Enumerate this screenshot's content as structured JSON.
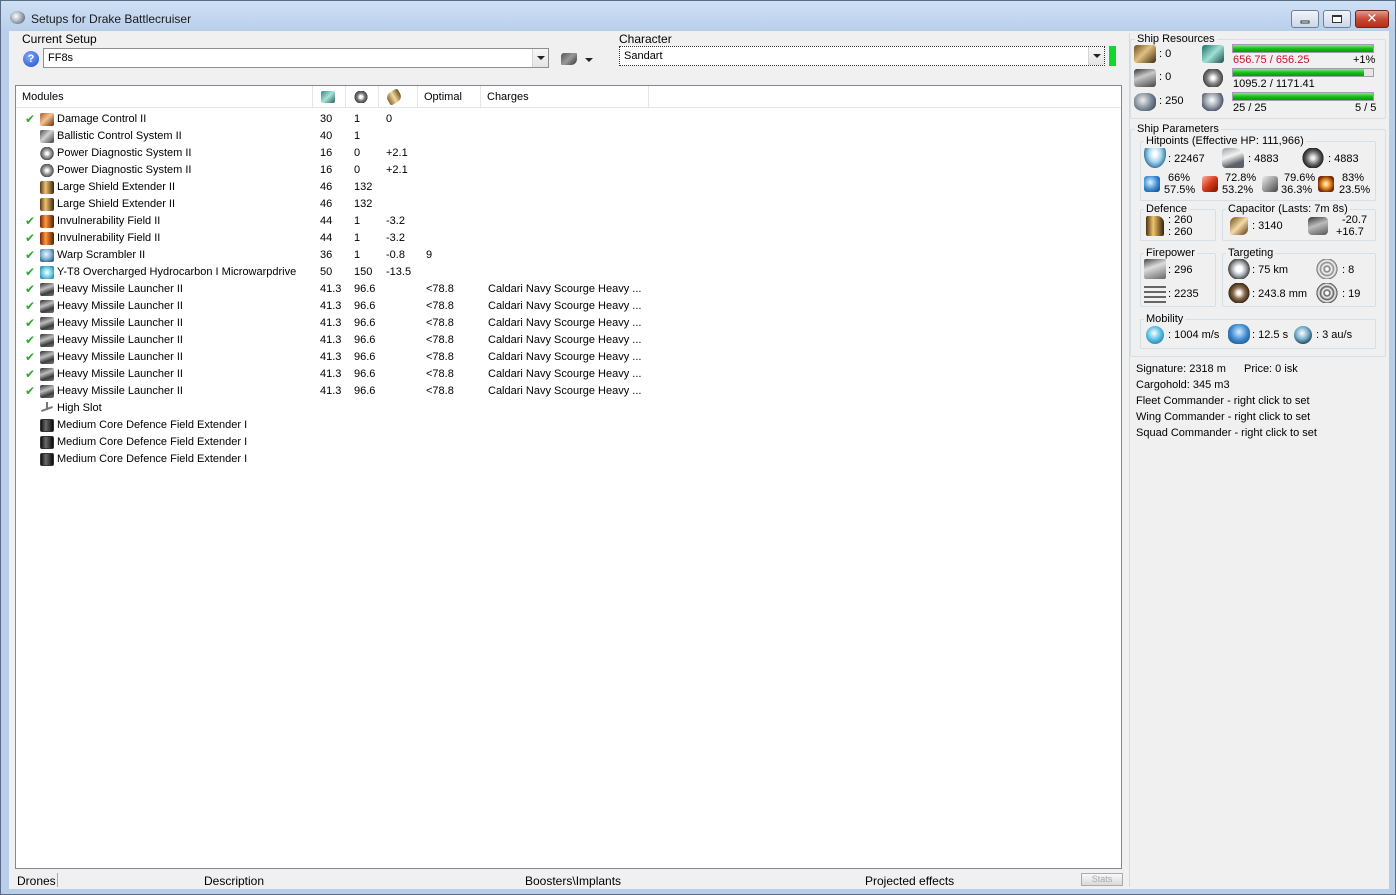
{
  "window": {
    "title": "Setups for Drake Battlecruiser"
  },
  "setup": {
    "label": "Current Setup",
    "value": "FF8s"
  },
  "character": {
    "label": "Character",
    "value": "Sandart"
  },
  "modules": {
    "headers": {
      "modules": "Modules",
      "optimal": "Optimal",
      "charges": "Charges"
    },
    "rows": [
      {
        "checked": true,
        "icon": "damage-control-icon",
        "name": "Damage Control II",
        "cpu": "30",
        "pg": "1",
        "cap": "0",
        "optimal": "",
        "charges": ""
      },
      {
        "checked": false,
        "icon": "ballistic-control-icon",
        "name": "Ballistic Control System II",
        "cpu": "40",
        "pg": "1",
        "cap": "",
        "optimal": "",
        "charges": ""
      },
      {
        "checked": false,
        "icon": "power-diagnostic-icon",
        "name": "Power Diagnostic System II",
        "cpu": "16",
        "pg": "0",
        "cap": "+2.1",
        "optimal": "",
        "charges": ""
      },
      {
        "checked": false,
        "icon": "power-diagnostic-icon",
        "name": "Power Diagnostic System II",
        "cpu": "16",
        "pg": "0",
        "cap": "+2.1",
        "optimal": "",
        "charges": ""
      },
      {
        "checked": false,
        "icon": "shield-extender-icon",
        "name": "Large Shield Extender II",
        "cpu": "46",
        "pg": "132",
        "cap": "",
        "optimal": "",
        "charges": ""
      },
      {
        "checked": false,
        "icon": "shield-extender-icon",
        "name": "Large Shield Extender II",
        "cpu": "46",
        "pg": "132",
        "cap": "",
        "optimal": "",
        "charges": ""
      },
      {
        "checked": true,
        "icon": "invulnerability-field-icon",
        "name": "Invulnerability Field II",
        "cpu": "44",
        "pg": "1",
        "cap": "-3.2",
        "optimal": "",
        "charges": ""
      },
      {
        "checked": true,
        "icon": "invulnerability-field-icon",
        "name": "Invulnerability Field II",
        "cpu": "44",
        "pg": "1",
        "cap": "-3.2",
        "optimal": "",
        "charges": ""
      },
      {
        "checked": true,
        "icon": "warp-scrambler-icon",
        "name": "Warp Scrambler II",
        "cpu": "36",
        "pg": "1",
        "cap": "-0.8",
        "optimal": "9",
        "charges": ""
      },
      {
        "checked": true,
        "icon": "microwarpdrive-icon",
        "name": "Y-T8 Overcharged Hydrocarbon I Microwarpdrive",
        "cpu": "50",
        "pg": "150",
        "cap": "-13.5",
        "optimal": "",
        "charges": ""
      },
      {
        "checked": true,
        "icon": "missile-launcher-icon",
        "name": "Heavy Missile Launcher II",
        "cpu": "41.3",
        "pg": "96.6",
        "cap": "",
        "optimal": "<78.8",
        "charges": "Caldari Navy Scourge Heavy ..."
      },
      {
        "checked": true,
        "icon": "missile-launcher-icon",
        "name": "Heavy Missile Launcher II",
        "cpu": "41.3",
        "pg": "96.6",
        "cap": "",
        "optimal": "<78.8",
        "charges": "Caldari Navy Scourge Heavy ..."
      },
      {
        "checked": true,
        "icon": "missile-launcher-icon",
        "name": "Heavy Missile Launcher II",
        "cpu": "41.3",
        "pg": "96.6",
        "cap": "",
        "optimal": "<78.8",
        "charges": "Caldari Navy Scourge Heavy ..."
      },
      {
        "checked": true,
        "icon": "missile-launcher-icon",
        "name": "Heavy Missile Launcher II",
        "cpu": "41.3",
        "pg": "96.6",
        "cap": "",
        "optimal": "<78.8",
        "charges": "Caldari Navy Scourge Heavy ..."
      },
      {
        "checked": true,
        "icon": "missile-launcher-icon",
        "name": "Heavy Missile Launcher II",
        "cpu": "41.3",
        "pg": "96.6",
        "cap": "",
        "optimal": "<78.8",
        "charges": "Caldari Navy Scourge Heavy ..."
      },
      {
        "checked": true,
        "icon": "missile-launcher-icon",
        "name": "Heavy Missile Launcher II",
        "cpu": "41.3",
        "pg": "96.6",
        "cap": "",
        "optimal": "<78.8",
        "charges": "Caldari Navy Scourge Heavy ..."
      },
      {
        "checked": true,
        "icon": "missile-launcher-icon",
        "name": "Heavy Missile Launcher II",
        "cpu": "41.3",
        "pg": "96.6",
        "cap": "",
        "optimal": "<78.8",
        "charges": "Caldari Navy Scourge Heavy ..."
      },
      {
        "checked": false,
        "icon": "empty-slot-icon",
        "name": "High Slot",
        "cpu": "",
        "pg": "",
        "cap": "",
        "optimal": "",
        "charges": ""
      },
      {
        "checked": false,
        "icon": "rig-icon",
        "name": "Medium Core Defence Field Extender I",
        "cpu": "",
        "pg": "",
        "cap": "",
        "optimal": "",
        "charges": ""
      },
      {
        "checked": false,
        "icon": "rig-icon",
        "name": "Medium Core Defence Field Extender I",
        "cpu": "",
        "pg": "",
        "cap": "",
        "optimal": "",
        "charges": ""
      },
      {
        "checked": false,
        "icon": "rig-icon",
        "name": "Medium Core Defence Field Extender I",
        "cpu": "",
        "pg": "",
        "cap": "",
        "optimal": "",
        "charges": ""
      }
    ]
  },
  "bottom_tabs": [
    "Drones",
    "Description",
    "Boosters\\Implants",
    "Projected effects"
  ],
  "stats_button": "Stats",
  "resources": {
    "label": "Ship Resources",
    "turrets": ": 0",
    "launchers": ": 0",
    "drone_bay": ": 250",
    "cpu": {
      "text": "656.75 / 656.25",
      "delta": "+1%",
      "fraction": 1.0
    },
    "powergrid": {
      "text": "1095.2 / 1171.41",
      "fraction": 0.935
    },
    "calibration": {
      "text": "25 / 25",
      "extra": "5 / 5",
      "fraction": 1.0
    },
    "cpu_color": "#c8102e"
  },
  "params": {
    "label": "Ship Parameters",
    "hitpoints": {
      "label": "Hitpoints (Effective HP: 111,966)",
      "shield": ": 22467",
      "armor": ": 4883",
      "hull": ": 4883",
      "em": [
        "66%",
        "57.5%"
      ],
      "thermal": [
        "72.8%",
        "53.2%"
      ],
      "kinetic": [
        "79.6%",
        "36.3%"
      ],
      "explosive": [
        "83%",
        "23.5%"
      ]
    },
    "defence": {
      "label": "Defence",
      "v1": ": 260",
      "v2": ": 260"
    },
    "capacitor": {
      "label": "Capacitor (Lasts: 7m 8s)",
      "amount": ": 3140",
      "rate1": "-20.7",
      "rate2": "+16.7"
    },
    "firepower": {
      "label": "Firepower",
      "dps": ": 296",
      "volley": ": 2235"
    },
    "targeting": {
      "label": "Targeting",
      "range": ": 75 km",
      "targets": ": 8",
      "scan": ": 243.8 mm",
      "sensor": ": 19"
    },
    "mobility": {
      "label": "Mobility",
      "speed": ": 1004 m/s",
      "align": ": 12.5 s",
      "warp": ": 3 au/s"
    }
  },
  "info": {
    "signature": "Signature: 2318 m",
    "price": "Price: 0 isk",
    "cargo": "Cargohold: 345 m3",
    "fleet": "Fleet Commander - right click to set",
    "wing": "Wing Commander - right click to set",
    "squad": "Squad Commander - right click to set"
  }
}
